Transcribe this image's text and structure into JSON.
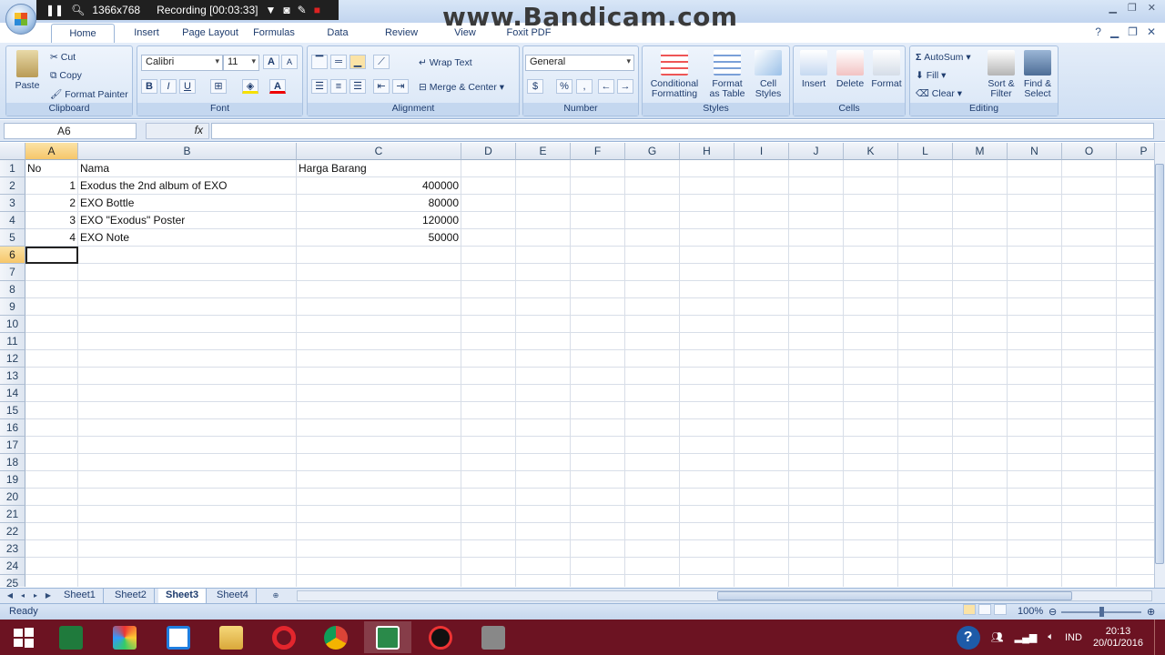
{
  "recorder": {
    "resolution": "1366x768",
    "status": "Recording [00:03:33]"
  },
  "watermark": "www.Bandicam.com",
  "ribbon_tabs": [
    "Home",
    "Insert",
    "Page Layout",
    "Formulas",
    "Data",
    "Review",
    "View",
    "Foxit PDF"
  ],
  "clipboard": {
    "paste": "Paste",
    "cut": "Cut",
    "copy": "Copy",
    "format_painter": "Format Painter",
    "label": "Clipboard"
  },
  "font": {
    "name": "Calibri",
    "size": "11",
    "label": "Font"
  },
  "alignment": {
    "wrap_text": "Wrap Text",
    "merge_center": "Merge & Center",
    "label": "Alignment"
  },
  "number": {
    "format": "General",
    "label": "Number"
  },
  "styles": {
    "conditional": "Conditional Formatting",
    "format_table": "Format as Table",
    "cell_styles": "Cell Styles",
    "label": "Styles"
  },
  "cells_group": {
    "insert": "Insert",
    "delete": "Delete",
    "format": "Format",
    "label": "Cells"
  },
  "editing": {
    "autosum": "AutoSum",
    "fill": "Fill",
    "clear": "Clear",
    "sort_filter": "Sort & Filter",
    "find_select": "Find & Select",
    "label": "Editing"
  },
  "formula_bar": {
    "name_box": "A6",
    "fx": "fx",
    "formula": ""
  },
  "columns": [
    "A",
    "B",
    "C",
    "D",
    "E",
    "F",
    "G",
    "H",
    "I",
    "J",
    "K",
    "L",
    "M",
    "N",
    "O",
    "P"
  ],
  "rows": [
    "1",
    "2",
    "3",
    "4",
    "5",
    "6",
    "7",
    "8",
    "9",
    "10",
    "11",
    "12",
    "13",
    "14",
    "15",
    "16",
    "17",
    "18",
    "19",
    "20",
    "21",
    "22",
    "23",
    "24",
    "25"
  ],
  "table": {
    "headers": [
      "No",
      "Nama",
      "Harga Barang"
    ],
    "rows": [
      [
        "1",
        "Exodus the 2nd album of EXO",
        "400000"
      ],
      [
        "2",
        "EXO Bottle",
        "80000"
      ],
      [
        "3",
        "EXO \"Exodus\" Poster",
        "120000"
      ],
      [
        "4",
        "EXO Note",
        "50000"
      ]
    ]
  },
  "sheets": [
    "Sheet1",
    "Sheet2",
    "Sheet3",
    "Sheet4"
  ],
  "active_sheet": "Sheet3",
  "status": {
    "ready": "Ready",
    "zoom": "100%"
  },
  "tray": {
    "lang": "IND",
    "time": "20:13",
    "date": "20/01/2016"
  }
}
